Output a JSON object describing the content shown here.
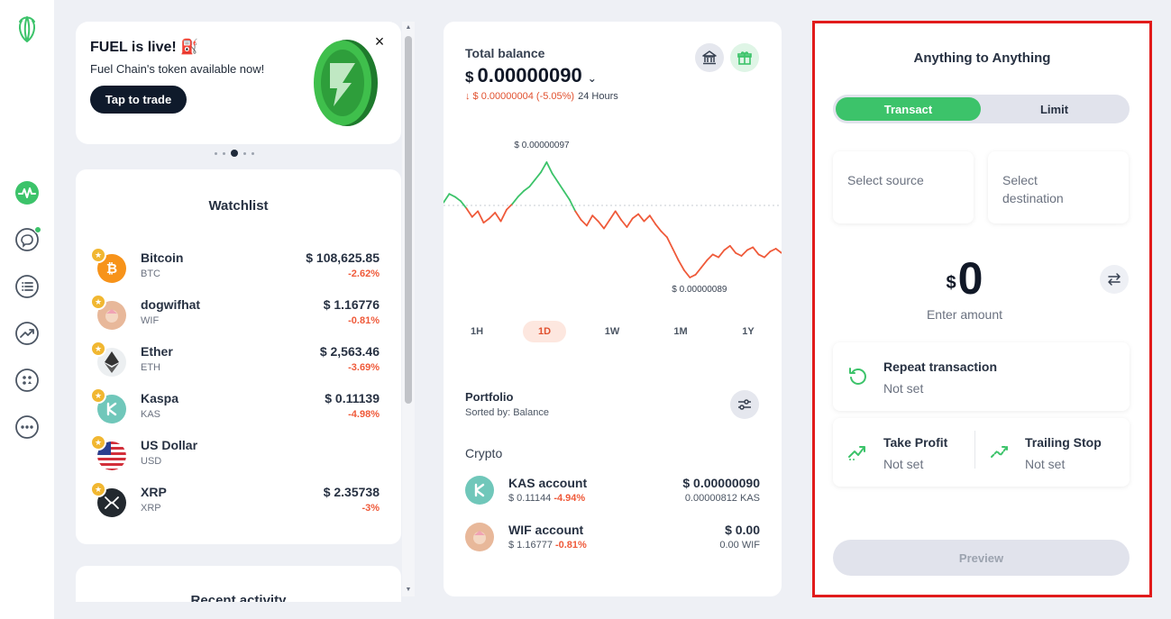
{
  "promo": {
    "title": "FUEL is live! ⛽",
    "subtitle": "Fuel Chain's token available now!",
    "cta": "Tap to trade",
    "close": "×"
  },
  "watchlist": {
    "title": "Watchlist",
    "items": [
      {
        "name": "Bitcoin",
        "symbol": "BTC",
        "price": "$ 108,625.85",
        "change": "-2.62%",
        "icon": "bitcoin-icon",
        "color": "#f7931a",
        "glyph": "₿"
      },
      {
        "name": "dogwifhat",
        "symbol": "WIF",
        "price": "$ 1.16776",
        "change": "-0.81%",
        "icon": "dogwifhat-icon",
        "color": "#e8b89a",
        "glyph": ""
      },
      {
        "name": "Ether",
        "symbol": "ETH",
        "price": "$ 2,563.46",
        "change": "-3.69%",
        "icon": "ether-icon",
        "color": "#eceff1",
        "glyph": ""
      },
      {
        "name": "Kaspa",
        "symbol": "KAS",
        "price": "$ 0.11139",
        "change": "-4.98%",
        "icon": "kaspa-icon",
        "color": "#70c7ba",
        "glyph": ""
      },
      {
        "name": "US Dollar",
        "symbol": "USD",
        "price": "",
        "change": "",
        "icon": "us-flag-icon",
        "color": "#ffffff",
        "glyph": ""
      },
      {
        "name": "XRP",
        "symbol": "XRP",
        "price": "$ 2.35738",
        "change": "-3%",
        "icon": "xrp-icon",
        "color": "#23292f",
        "glyph": ""
      }
    ]
  },
  "recent": {
    "title": "Recent activity"
  },
  "balance": {
    "label": "Total balance",
    "currency": "$",
    "value": "0.00000090",
    "change": "↓ $ 0.00000004 (-5.05%)",
    "period": "24 Hours"
  },
  "chart_data": {
    "type": "line",
    "title": "",
    "high_label": "$ 0.00000097",
    "low_label": "$ 0.00000089",
    "reference_value": 9.4e-08,
    "ylim": [
      8.8e-08,
      9.8e-08
    ],
    "x": [
      0,
      1,
      2,
      3,
      4,
      5,
      6,
      7,
      8,
      9,
      10,
      11,
      12,
      13,
      14,
      15,
      16,
      17,
      18,
      19,
      20,
      21,
      22,
      23,
      24,
      25,
      26,
      27,
      28,
      29,
      30,
      31,
      32,
      33,
      34,
      35,
      36,
      37,
      38,
      39,
      40,
      41,
      42,
      43,
      44,
      45,
      46,
      47,
      48,
      49,
      50,
      51,
      52,
      53,
      54,
      55,
      56,
      57,
      58,
      59
    ],
    "values": [
      9.42e-08,
      9.48e-08,
      9.46e-08,
      9.43e-08,
      9.38e-08,
      9.32e-08,
      9.36e-08,
      9.28e-08,
      9.31e-08,
      9.35e-08,
      9.29e-08,
      9.37e-08,
      9.41e-08,
      9.46e-08,
      9.5e-08,
      9.53e-08,
      9.58e-08,
      9.63e-08,
      9.7e-08,
      9.62e-08,
      9.56e-08,
      9.5e-08,
      9.44e-08,
      9.36e-08,
      9.3e-08,
      9.26e-08,
      9.33e-08,
      9.29e-08,
      9.24e-08,
      9.3e-08,
      9.36e-08,
      9.3e-08,
      9.25e-08,
      9.31e-08,
      9.34e-08,
      9.29e-08,
      9.33e-08,
      9.27e-08,
      9.22e-08,
      9.18e-08,
      9.1e-08,
      9.02e-08,
      8.95e-08,
      8.9e-08,
      8.92e-08,
      8.97e-08,
      9.02e-08,
      9.06e-08,
      9.04e-08,
      9.09e-08,
      9.12e-08,
      9.07e-08,
      9.05e-08,
      9.09e-08,
      9.11e-08,
      9.06e-08,
      9.04e-08,
      9.08e-08,
      9.1e-08,
      9.07e-08
    ],
    "colors": {
      "up": "#3cc36a",
      "down": "#ef5a3a"
    }
  },
  "ranges": [
    {
      "label": "1H",
      "active": false
    },
    {
      "label": "1D",
      "active": true
    },
    {
      "label": "1W",
      "active": false
    },
    {
      "label": "1M",
      "active": false
    },
    {
      "label": "1Y",
      "active": false
    }
  ],
  "portfolio": {
    "title": "Portfolio",
    "sorted": "Sorted by: Balance",
    "section": "Crypto",
    "accounts": [
      {
        "name": "KAS account",
        "price": "$ 0.11144",
        "change": "-4.94%",
        "value": "$ 0.00000090",
        "qty": "0.00000812 KAS",
        "color": "#70c7ba"
      },
      {
        "name": "WIF account",
        "price": "$ 1.16777",
        "change": "-0.81%",
        "value": "$ 0.00",
        "qty": "0.00 WIF",
        "color": "#e8b89a"
      }
    ]
  },
  "trade": {
    "title": "Anything to Anything",
    "tab_transact": "Transact",
    "tab_limit": "Limit",
    "source": "Select source",
    "destination": "Select destination",
    "currency": "$",
    "amount": "0",
    "amount_label": "Enter amount",
    "repeat_title": "Repeat transaction",
    "repeat_value": "Not set",
    "take_profit_title": "Take Profit",
    "take_profit_value": "Not set",
    "trailing_title": "Trailing Stop",
    "trailing_value": "Not set",
    "preview": "Preview"
  },
  "colors": {
    "accent": "#3cc36a",
    "negative": "#ef5a3a",
    "highlight": "#e11b1b"
  }
}
